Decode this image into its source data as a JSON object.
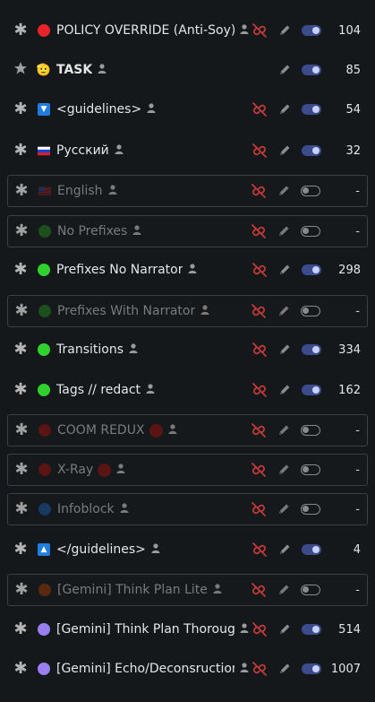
{
  "colors": {
    "red_dot": "#e8232b",
    "green_dot": "#2fd12c",
    "dim_green_dot": "#1e4d1e",
    "dim_red_dot": "#5b1414",
    "dim_blue_dot": "#173a5e",
    "dim_orange_dot": "#5a2a10",
    "purple_dot": "#9a7ff0",
    "blue_box": "#1f7ee0",
    "toggle_on": "#3b4b8c",
    "unlink_red": "#c43a3a"
  },
  "rows": [
    {
      "name": "POLICY OVERRIDE (Anti-Soy)",
      "marker": "red-dot",
      "count": "104",
      "enabled": true,
      "unlink": true,
      "star": false,
      "boxed": false,
      "bold": false
    },
    {
      "name": "TASK",
      "marker": "salute-emoji",
      "marker_glyph": "🫡",
      "count": "85",
      "enabled": true,
      "unlink": false,
      "star": true,
      "boxed": false,
      "bold": true
    },
    {
      "name": "<guidelines>",
      "marker": "blue-down-box",
      "marker_glyph": "▼",
      "count": "54",
      "enabled": true,
      "unlink": true,
      "star": false,
      "boxed": false,
      "bold": false
    },
    {
      "name": "Русский",
      "marker": "russian-flag",
      "count": "32",
      "enabled": true,
      "unlink": true,
      "star": false,
      "boxed": false,
      "bold": false
    },
    {
      "name": "English",
      "marker": "us-flag",
      "count": "-",
      "enabled": false,
      "unlink": true,
      "star": false,
      "boxed": true,
      "bold": false
    },
    {
      "name": "No Prefixes",
      "marker": "dim-green-dot",
      "count": "-",
      "enabled": false,
      "unlink": true,
      "star": false,
      "boxed": true,
      "bold": false
    },
    {
      "name": "Prefixes No Narrator",
      "marker": "green-dot",
      "count": "298",
      "enabled": true,
      "unlink": true,
      "star": false,
      "boxed": false,
      "bold": false
    },
    {
      "name": "Prefixes With Narrator",
      "marker": "dim-green-dot",
      "count": "-",
      "enabled": false,
      "unlink": true,
      "star": false,
      "boxed": true,
      "bold": false
    },
    {
      "name": "Transitions",
      "marker": "green-dot",
      "count": "334",
      "enabled": true,
      "unlink": true,
      "star": false,
      "boxed": false,
      "bold": false
    },
    {
      "name": "Tags // redact",
      "marker": "green-dot",
      "count": "162",
      "enabled": true,
      "unlink": true,
      "star": false,
      "boxed": false,
      "bold": false
    },
    {
      "name": "COOM REDUX",
      "marker": "dim-red-dot",
      "trail_dot": true,
      "count": "-",
      "enabled": false,
      "unlink": true,
      "star": false,
      "boxed": true,
      "bold": false
    },
    {
      "name": "X-Ray",
      "marker": "dim-red-dot",
      "trail_dot": true,
      "count": "-",
      "enabled": false,
      "unlink": true,
      "star": false,
      "boxed": true,
      "bold": false
    },
    {
      "name": "Infoblock",
      "marker": "dim-blue-dot",
      "count": "-",
      "enabled": false,
      "unlink": true,
      "star": false,
      "boxed": true,
      "bold": false
    },
    {
      "name": "</guidelines>",
      "marker": "blue-up-box",
      "marker_glyph": "▲",
      "count": "4",
      "enabled": true,
      "unlink": true,
      "star": false,
      "boxed": false,
      "bold": false
    },
    {
      "name": "[Gemini] Think Plan Lite",
      "marker": "dim-orange-dot",
      "count": "-",
      "enabled": false,
      "unlink": true,
      "star": false,
      "boxed": true,
      "bold": false
    },
    {
      "name": "[Gemini] Think Plan Thorough",
      "marker": "purple-dot",
      "count": "514",
      "enabled": true,
      "unlink": true,
      "star": false,
      "boxed": false,
      "bold": false
    },
    {
      "name": "[Gemini] Echo/Deconsruction",
      "marker": "purple-dot",
      "count": "1007",
      "enabled": true,
      "unlink": true,
      "star": false,
      "boxed": false,
      "bold": false
    }
  ],
  "icons": {
    "drag": "asterisk-icon",
    "star": "star-icon",
    "person": "person-icon",
    "unlink": "unlink-icon",
    "edit": "pencil-icon"
  }
}
